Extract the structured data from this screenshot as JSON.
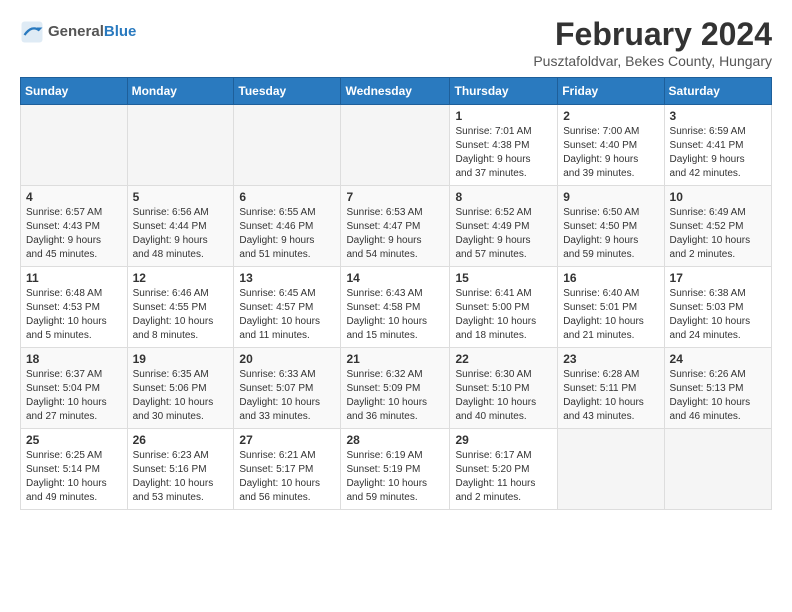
{
  "header": {
    "logo_general": "General",
    "logo_blue": "Blue",
    "title": "February 2024",
    "subtitle": "Pusztafoldvar, Bekes County, Hungary"
  },
  "weekdays": [
    "Sunday",
    "Monday",
    "Tuesday",
    "Wednesday",
    "Thursday",
    "Friday",
    "Saturday"
  ],
  "weeks": [
    [
      {
        "day": "",
        "info": ""
      },
      {
        "day": "",
        "info": ""
      },
      {
        "day": "",
        "info": ""
      },
      {
        "day": "",
        "info": ""
      },
      {
        "day": "1",
        "info": "Sunrise: 7:01 AM\nSunset: 4:38 PM\nDaylight: 9 hours\nand 37 minutes."
      },
      {
        "day": "2",
        "info": "Sunrise: 7:00 AM\nSunset: 4:40 PM\nDaylight: 9 hours\nand 39 minutes."
      },
      {
        "day": "3",
        "info": "Sunrise: 6:59 AM\nSunset: 4:41 PM\nDaylight: 9 hours\nand 42 minutes."
      }
    ],
    [
      {
        "day": "4",
        "info": "Sunrise: 6:57 AM\nSunset: 4:43 PM\nDaylight: 9 hours\nand 45 minutes."
      },
      {
        "day": "5",
        "info": "Sunrise: 6:56 AM\nSunset: 4:44 PM\nDaylight: 9 hours\nand 48 minutes."
      },
      {
        "day": "6",
        "info": "Sunrise: 6:55 AM\nSunset: 4:46 PM\nDaylight: 9 hours\nand 51 minutes."
      },
      {
        "day": "7",
        "info": "Sunrise: 6:53 AM\nSunset: 4:47 PM\nDaylight: 9 hours\nand 54 minutes."
      },
      {
        "day": "8",
        "info": "Sunrise: 6:52 AM\nSunset: 4:49 PM\nDaylight: 9 hours\nand 57 minutes."
      },
      {
        "day": "9",
        "info": "Sunrise: 6:50 AM\nSunset: 4:50 PM\nDaylight: 9 hours\nand 59 minutes."
      },
      {
        "day": "10",
        "info": "Sunrise: 6:49 AM\nSunset: 4:52 PM\nDaylight: 10 hours\nand 2 minutes."
      }
    ],
    [
      {
        "day": "11",
        "info": "Sunrise: 6:48 AM\nSunset: 4:53 PM\nDaylight: 10 hours\nand 5 minutes."
      },
      {
        "day": "12",
        "info": "Sunrise: 6:46 AM\nSunset: 4:55 PM\nDaylight: 10 hours\nand 8 minutes."
      },
      {
        "day": "13",
        "info": "Sunrise: 6:45 AM\nSunset: 4:57 PM\nDaylight: 10 hours\nand 11 minutes."
      },
      {
        "day": "14",
        "info": "Sunrise: 6:43 AM\nSunset: 4:58 PM\nDaylight: 10 hours\nand 15 minutes."
      },
      {
        "day": "15",
        "info": "Sunrise: 6:41 AM\nSunset: 5:00 PM\nDaylight: 10 hours\nand 18 minutes."
      },
      {
        "day": "16",
        "info": "Sunrise: 6:40 AM\nSunset: 5:01 PM\nDaylight: 10 hours\nand 21 minutes."
      },
      {
        "day": "17",
        "info": "Sunrise: 6:38 AM\nSunset: 5:03 PM\nDaylight: 10 hours\nand 24 minutes."
      }
    ],
    [
      {
        "day": "18",
        "info": "Sunrise: 6:37 AM\nSunset: 5:04 PM\nDaylight: 10 hours\nand 27 minutes."
      },
      {
        "day": "19",
        "info": "Sunrise: 6:35 AM\nSunset: 5:06 PM\nDaylight: 10 hours\nand 30 minutes."
      },
      {
        "day": "20",
        "info": "Sunrise: 6:33 AM\nSunset: 5:07 PM\nDaylight: 10 hours\nand 33 minutes."
      },
      {
        "day": "21",
        "info": "Sunrise: 6:32 AM\nSunset: 5:09 PM\nDaylight: 10 hours\nand 36 minutes."
      },
      {
        "day": "22",
        "info": "Sunrise: 6:30 AM\nSunset: 5:10 PM\nDaylight: 10 hours\nand 40 minutes."
      },
      {
        "day": "23",
        "info": "Sunrise: 6:28 AM\nSunset: 5:11 PM\nDaylight: 10 hours\nand 43 minutes."
      },
      {
        "day": "24",
        "info": "Sunrise: 6:26 AM\nSunset: 5:13 PM\nDaylight: 10 hours\nand 46 minutes."
      }
    ],
    [
      {
        "day": "25",
        "info": "Sunrise: 6:25 AM\nSunset: 5:14 PM\nDaylight: 10 hours\nand 49 minutes."
      },
      {
        "day": "26",
        "info": "Sunrise: 6:23 AM\nSunset: 5:16 PM\nDaylight: 10 hours\nand 53 minutes."
      },
      {
        "day": "27",
        "info": "Sunrise: 6:21 AM\nSunset: 5:17 PM\nDaylight: 10 hours\nand 56 minutes."
      },
      {
        "day": "28",
        "info": "Sunrise: 6:19 AM\nSunset: 5:19 PM\nDaylight: 10 hours\nand 59 minutes."
      },
      {
        "day": "29",
        "info": "Sunrise: 6:17 AM\nSunset: 5:20 PM\nDaylight: 11 hours\nand 2 minutes."
      },
      {
        "day": "",
        "info": ""
      },
      {
        "day": "",
        "info": ""
      }
    ]
  ]
}
